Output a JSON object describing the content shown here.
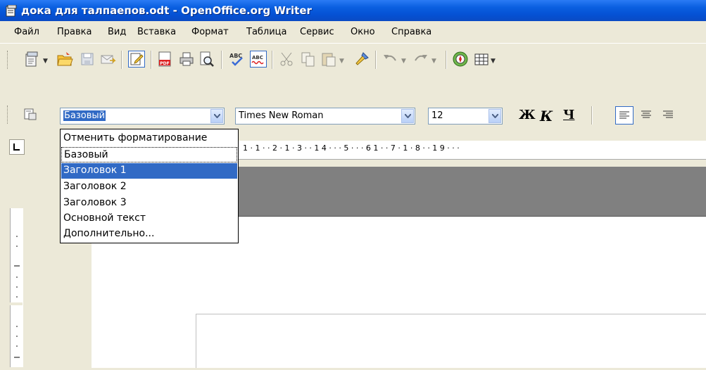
{
  "window": {
    "title": "дока для талпаепов.odt - OpenOffice.org Writer"
  },
  "menu": {
    "items": [
      "Файл",
      "Правка",
      "Вид",
      "Вставка",
      "Формат",
      "Таблица",
      "Сервис",
      "Окно",
      "Справка"
    ]
  },
  "toolbar_standard": {
    "icons": [
      "new-document-icon",
      "open-folder-icon",
      "save-icon",
      "email-icon",
      "edit-mode-icon",
      "export-pdf-icon",
      "print-icon",
      "page-preview-icon",
      "spellcheck-icon",
      "autospellcheck-icon",
      "cut-icon",
      "copy-icon",
      "paste-icon",
      "format-paintbrush-icon",
      "undo-icon",
      "redo-icon",
      "navigator-icon",
      "table-icon"
    ]
  },
  "toolbar_formatting": {
    "style_value": "Базовый",
    "font_value": "Times New Roman",
    "size_value": "12",
    "bold_label": "Ж",
    "italic_label": "К",
    "underline_label": "Ч"
  },
  "style_dropdown": {
    "options": [
      "Отменить форматирование",
      "Базовый",
      "Заголовок 1",
      "Заголовок 2",
      "Заголовок 3",
      "Основной текст",
      "Дополнительно..."
    ],
    "selected": "Заголовок 1"
  },
  "ruler": {
    "horizontal_text": "1 · 1 · · 2 · 1 · 3 · · 1 4 · · · 5 · · · 6 1 · · 7 · 1 · 8 · · 1 9 · · ·"
  },
  "colors": {
    "titlebar": "#0a5fe0",
    "selection": "#316ac5",
    "chrome": "#ece9d8"
  }
}
